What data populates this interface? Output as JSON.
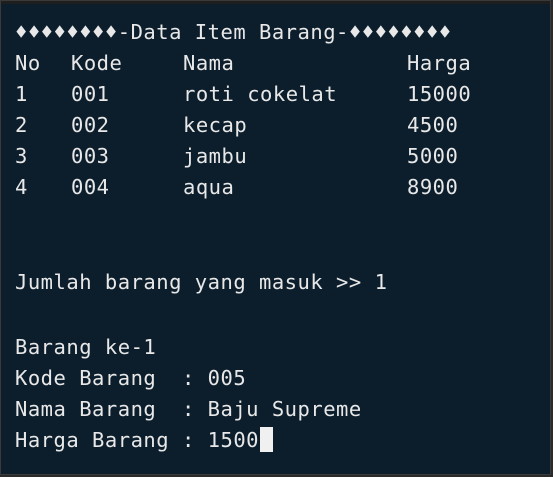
{
  "header": "♦♦♦♦♦♦♦♦-Data Item Barang-♦♦♦♦♦♦♦♦",
  "columns": [
    "No",
    "Kode",
    "Nama",
    "Harga"
  ],
  "rows": [
    {
      "no": "1",
      "kode": "001",
      "nama": "roti cokelat",
      "harga": "15000"
    },
    {
      "no": "2",
      "kode": "002",
      "nama": "kecap",
      "harga": "4500"
    },
    {
      "no": "3",
      "kode": "003",
      "nama": "jambu",
      "harga": "5000"
    },
    {
      "no": "4",
      "kode": "004",
      "nama": "aqua",
      "harga": "8900"
    }
  ],
  "prompt_count": "Jumlah barang yang masuk >> 1",
  "entry_title": "Barang ke-1",
  "kode_line": "Kode Barang  : 005",
  "nama_line": "Nama Barang  : Baju Supreme",
  "harga_line": "Harga Barang : 1500"
}
